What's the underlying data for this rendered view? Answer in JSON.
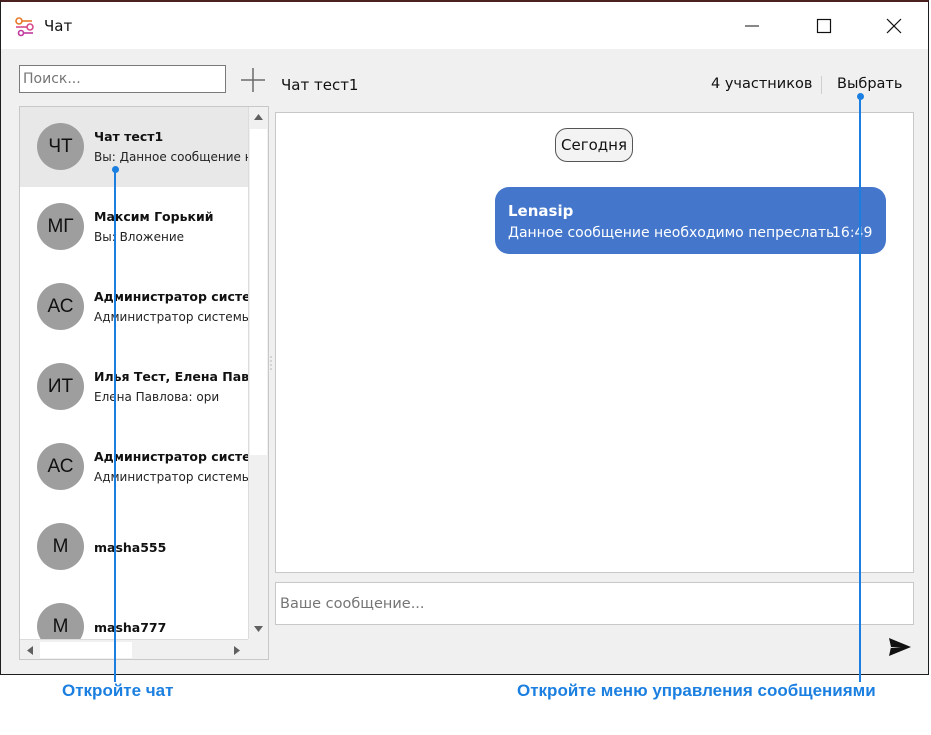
{
  "window": {
    "title": "Чат",
    "controls": [
      "minimize-icon",
      "maximize-icon",
      "close-icon"
    ]
  },
  "sidebar": {
    "search_placeholder": "Поиск...",
    "add_icon": "plus-icon",
    "chats": [
      {
        "initials": "ЧТ",
        "name": "Чат тест1",
        "preview": "Вы: Данное сообщение необходимо пепреслать",
        "selected": true
      },
      {
        "initials": "МГ",
        "name": "Максим Горький",
        "preview": "Вы: Вложение"
      },
      {
        "initials": "АС",
        "name": "Администратор системы",
        "preview": "Администратор системы: "
      },
      {
        "initials": "ИТ",
        "name": "Илья Тест, Елена Павлова",
        "preview": "Елена Павлова: ори"
      },
      {
        "initials": "АС",
        "name": "Администратор системы",
        "preview": "Администратор системы: "
      },
      {
        "initials": "М",
        "name": "masha555",
        "preview": ""
      },
      {
        "initials": "М",
        "name": "masha777",
        "preview": ""
      }
    ]
  },
  "header": {
    "chat_title": "Чат тест1",
    "participants": "4 участников",
    "select_label": "Выбрать"
  },
  "messages": {
    "date_separator": "Сегодня",
    "items": [
      {
        "author": "Lenasip",
        "text": "Данное сообщение необходимо пепреслать",
        "time": "16:49",
        "color": "#4477cc"
      }
    ]
  },
  "composer": {
    "placeholder": "Ваше сообщение...",
    "send_icon": "send-icon"
  },
  "annotations": {
    "open_chat": "Откройте чат",
    "open_menu": "Откройте меню управления сообщениями",
    "color": "#1a7fe0"
  }
}
